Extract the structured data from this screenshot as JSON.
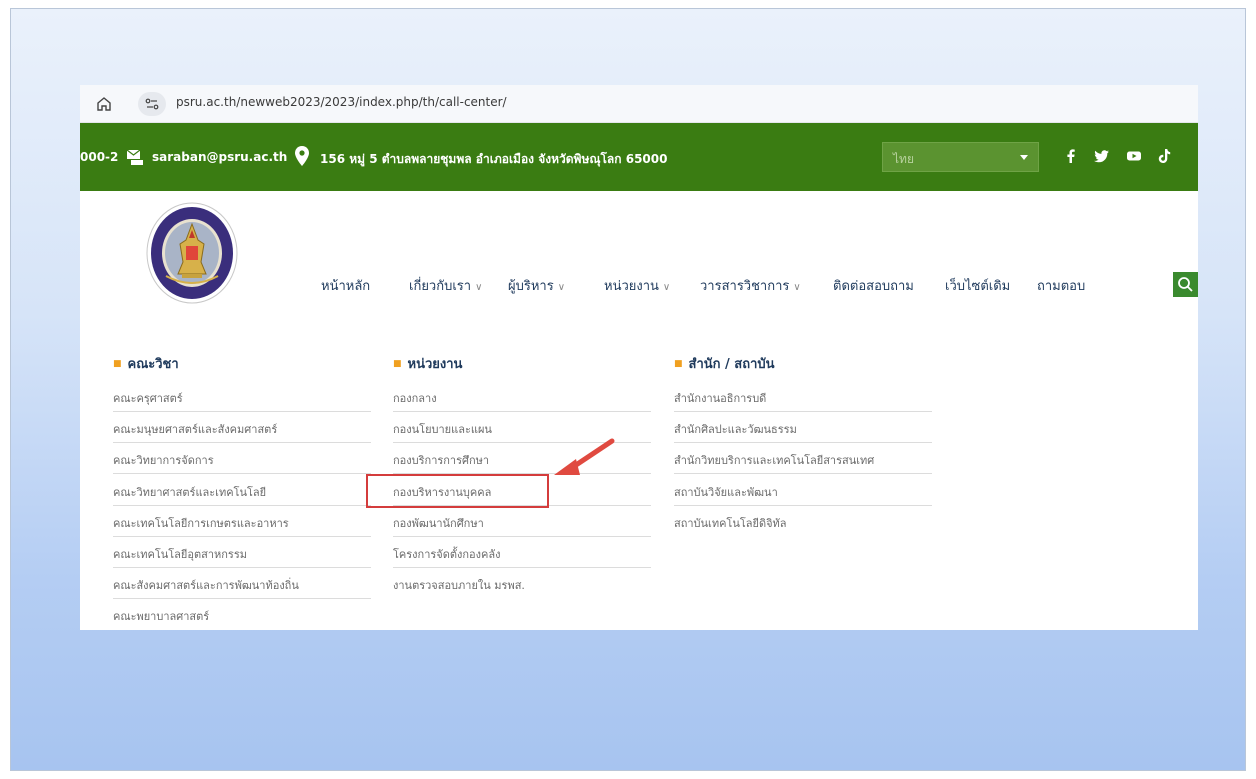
{
  "browser": {
    "url": "psru.ac.th/newweb2023/2023/index.php/th/call-center/"
  },
  "topbar": {
    "phone": "000-2",
    "email": "saraban@psru.ac.th",
    "address": "156 หมู่ 5 ตำบลพลายชุมพล อำเภอเมือง จังหวัดพิษณุโลก 65000",
    "language": "ไทย"
  },
  "nav": {
    "items": [
      {
        "label": "หน้าหลัก",
        "has_dropdown": false
      },
      {
        "label": "เกี่ยวกับเรา",
        "has_dropdown": true
      },
      {
        "label": "ผู้บริหาร",
        "has_dropdown": true
      },
      {
        "label": "หน่วยงาน",
        "has_dropdown": true
      },
      {
        "label": "วารสารวิชาการ",
        "has_dropdown": true
      },
      {
        "label": "ติดต่อสอบถาม",
        "has_dropdown": false
      },
      {
        "label": "เว็บไซต์เดิม",
        "has_dropdown": false
      },
      {
        "label": "ถามตอบ",
        "has_dropdown": false
      }
    ],
    "chevron": "∨"
  },
  "megamenu": {
    "faculty": {
      "heading": "คณะวิชา",
      "items": [
        "คณะครุศาสตร์",
        "คณะมนุษยศาสตร์และสังคมศาสตร์",
        "คณะวิทยาการจัดการ",
        "คณะวิทยาศาสตร์และเทคโนโลยี",
        "คณะเทคโนโลยีการเกษตรและอาหาร",
        "คณะเทคโนโลยีอุตสาหกรรม",
        "คณะสังคมศาสตร์และการพัฒนาท้องถิ่น",
        "คณะพยาบาลศาสตร์"
      ]
    },
    "units": {
      "heading": "หน่วยงาน",
      "items": [
        "กองกลาง",
        "กองนโยบายและแผน",
        "กองบริการการศึกษา",
        "กองบริหารงานบุคคล",
        "กองพัฒนานักศึกษา",
        "โครงการจัดตั้งกองคลัง",
        "งานตรวจสอบภายใน มรพส."
      ]
    },
    "offices": {
      "heading": "สำนัก / สถาบัน",
      "items": [
        "สำนักงานอธิการบดี",
        "สำนักศิลปะและวัฒนธรรม",
        "สำนักวิทยบริการและเทคโนโลยีสารสนเทศ",
        "สถาบันวิจัยและพัฒนา",
        "สถาบันเทคโนโลยีดิจิทัล"
      ]
    }
  },
  "colors": {
    "topbar": "#3a7c12",
    "nav_text": "#1f3a5c",
    "highlight": "#d43c3c",
    "bullet": "#f0a020"
  }
}
